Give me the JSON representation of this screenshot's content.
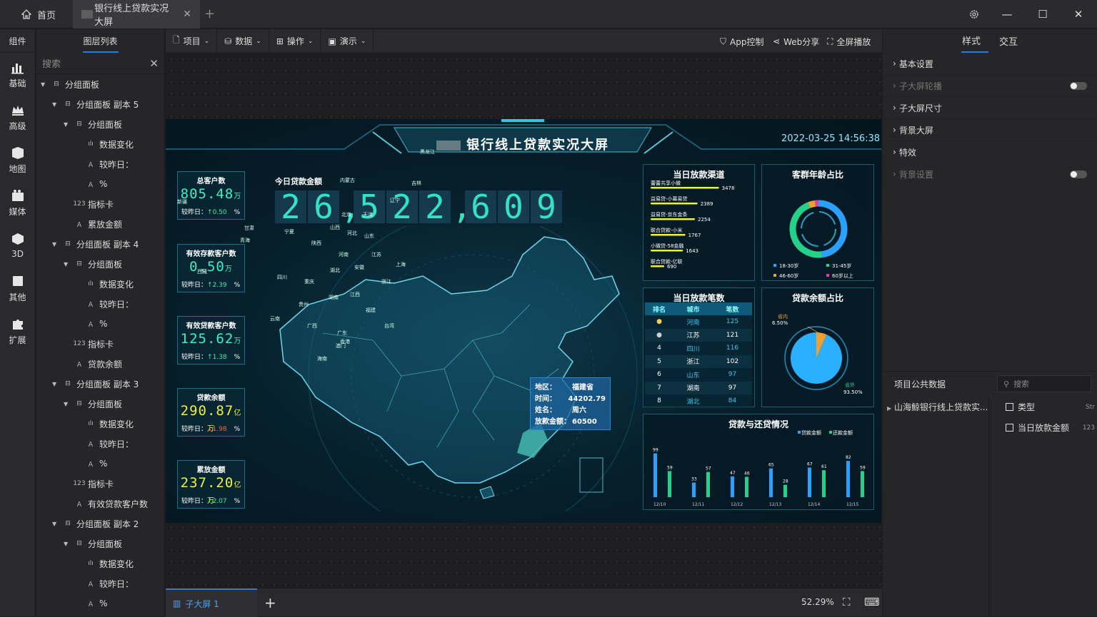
{
  "titlebar": {
    "home_tab": "首页",
    "active_tab": "银行线上贷款实况大屏"
  },
  "leftnav": {
    "title": "组件",
    "items": [
      {
        "label": "基础",
        "icon": "bar-chart-icon"
      },
      {
        "label": "高级",
        "icon": "crown-icon"
      },
      {
        "label": "地图",
        "icon": "map-icon"
      },
      {
        "label": "媒体",
        "icon": "media-icon"
      },
      {
        "label": "3D",
        "icon": "cube-icon"
      },
      {
        "label": "其他",
        "icon": "list-icon"
      },
      {
        "label": "扩展",
        "icon": "puzzle-icon"
      }
    ]
  },
  "layers": {
    "title": "图层列表",
    "search_placeholder": "搜索",
    "rows": [
      {
        "label": "分组面板",
        "level": 0,
        "arrow": true,
        "icon": "group"
      },
      {
        "label": "分组面板 副本 5",
        "level": 1,
        "arrow": true,
        "icon": "group"
      },
      {
        "label": "分组面板",
        "level": 2,
        "arrow": true,
        "icon": "group"
      },
      {
        "label": "数据变化",
        "level": 3,
        "arrow": false,
        "icon": "bar"
      },
      {
        "label": "较昨日：",
        "level": 3,
        "arrow": false,
        "icon": "text"
      },
      {
        "label": "%",
        "level": 3,
        "arrow": false,
        "icon": "text"
      },
      {
        "label": "指标卡",
        "level": 2,
        "arrow": false,
        "icon": "num"
      },
      {
        "label": "累放金额",
        "level": 2,
        "arrow": false,
        "icon": "text"
      },
      {
        "label": "分组面板 副本 4",
        "level": 1,
        "arrow": true,
        "icon": "group"
      },
      {
        "label": "分组面板",
        "level": 2,
        "arrow": true,
        "icon": "group"
      },
      {
        "label": "数据变化",
        "level": 3,
        "arrow": false,
        "icon": "bar"
      },
      {
        "label": "较昨日：",
        "level": 3,
        "arrow": false,
        "icon": "text"
      },
      {
        "label": "%",
        "level": 3,
        "arrow": false,
        "icon": "text"
      },
      {
        "label": "指标卡",
        "level": 2,
        "arrow": false,
        "icon": "num"
      },
      {
        "label": "贷款余额",
        "level": 2,
        "arrow": false,
        "icon": "text"
      },
      {
        "label": "分组面板 副本 3",
        "level": 1,
        "arrow": true,
        "icon": "group"
      },
      {
        "label": "分组面板",
        "level": 2,
        "arrow": true,
        "icon": "group"
      },
      {
        "label": "数据变化",
        "level": 3,
        "arrow": false,
        "icon": "bar"
      },
      {
        "label": "较昨日：",
        "level": 3,
        "arrow": false,
        "icon": "text"
      },
      {
        "label": "%",
        "level": 3,
        "arrow": false,
        "icon": "text"
      },
      {
        "label": "指标卡",
        "level": 2,
        "arrow": false,
        "icon": "num"
      },
      {
        "label": "有效贷款客户数",
        "level": 2,
        "arrow": false,
        "icon": "text"
      },
      {
        "label": "分组面板 副本 2",
        "level": 1,
        "arrow": true,
        "icon": "group"
      },
      {
        "label": "分组面板",
        "level": 2,
        "arrow": true,
        "icon": "group"
      },
      {
        "label": "数据变化",
        "level": 3,
        "arrow": false,
        "icon": "bar"
      },
      {
        "label": "较昨日：",
        "level": 3,
        "arrow": false,
        "icon": "text"
      },
      {
        "label": "%",
        "level": 3,
        "arrow": false,
        "icon": "text"
      }
    ]
  },
  "toolbar": {
    "menus": [
      "项目",
      "数据",
      "操作",
      "演示"
    ],
    "app_control": "App控制",
    "web_share": "Web分享",
    "fullscreen": "全屏播放"
  },
  "bottombar": {
    "sub_screen": "子大屏 1",
    "zoom": "52.29%"
  },
  "props": {
    "tabs": [
      "样式",
      "交互"
    ],
    "rows": [
      {
        "label": "基本设置",
        "dim": false,
        "toggle": false
      },
      {
        "label": "子大屏轮播",
        "dim": true,
        "toggle": true
      },
      {
        "label": "子大屏尺寸",
        "dim": false,
        "toggle": false
      },
      {
        "label": "背景大屏",
        "dim": false,
        "toggle": false
      },
      {
        "label": "特效",
        "dim": false,
        "toggle": false
      },
      {
        "label": "背景设置",
        "dim": true,
        "toggle": true
      }
    ],
    "public_data_title": "项目公共数据",
    "search_placeholder": "搜索",
    "project_item": "山海鲸银行线上贷款实...",
    "fields": [
      {
        "label": "类型",
        "type": "Str"
      },
      {
        "label": "当日放款金额",
        "type": "123"
      }
    ]
  },
  "screen": {
    "title": "银行线上贷款实况大屏",
    "datetime": "2022-03-25 14:56:38",
    "today_amount_label": "今日贷款金额",
    "today_amount": "26,522,609",
    "kpis": [
      {
        "title": "总客户数",
        "value": "805.48",
        "unit": "万",
        "compare_label": "较昨日：",
        "change": "0.50",
        "dir": "up",
        "pct": "%"
      },
      {
        "title": "有效存款客户数",
        "value": "0.50",
        "unit": "万",
        "compare_label": "较昨日：",
        "change": "2.39",
        "dir": "up",
        "pct": "%"
      },
      {
        "title": "有效贷款客户数",
        "value": "125.62",
        "unit": "万",
        "compare_label": "较昨日：",
        "change": "1.38",
        "dir": "up",
        "pct": "%"
      },
      {
        "title": "贷款余额",
        "value": "290.87",
        "unit": "亿万",
        "compare_label": "较昨日：",
        "change": "1.98",
        "dir": "down",
        "pct": "%"
      },
      {
        "title": "累放金额",
        "value": "237.20",
        "unit": "亿万",
        "compare_label": "较昨日：",
        "change": "2.07",
        "dir": "up",
        "pct": "%"
      }
    ],
    "map_tooltip": {
      "rows": [
        {
          "k": "地区：",
          "v": "福建省"
        },
        {
          "k": "时间：",
          "v": "44202.79"
        },
        {
          "k": "姓名：",
          "v": "周六"
        },
        {
          "k": "放款金额：",
          "v": "60500"
        }
      ]
    },
    "map_labels": [
      "新疆",
      "西藏",
      "青海",
      "甘肃",
      "内蒙古",
      "黑龙江",
      "吉林",
      "辽宁",
      "北京",
      "天津",
      "河北",
      "山西",
      "陕西",
      "宁夏",
      "山东",
      "河南",
      "江苏",
      "安徽",
      "湖北",
      "四川",
      "重庆",
      "湖南",
      "江西",
      "浙江",
      "福建",
      "贵州",
      "云南",
      "广西",
      "广东",
      "海南",
      "台湾",
      "上海",
      "香港",
      "澳门"
    ],
    "channel_panel": {
      "title": "当日放款渠道"
    },
    "age_panel": {
      "title": "客群年龄占比",
      "legend": [
        "18-30岁",
        "31-45岁",
        "46-60岁",
        "60岁以上"
      ]
    },
    "count_panel": {
      "title": "当日放款笔数",
      "headers": [
        "排名",
        "城市",
        "笔数"
      ],
      "rows": [
        {
          "rank": "",
          "city": "河南",
          "count": "125",
          "medal": "gold"
        },
        {
          "rank": "",
          "city": "江苏",
          "count": "121",
          "medal": "silver"
        },
        {
          "rank": "4",
          "city": "四川",
          "count": "116",
          "medal": ""
        },
        {
          "rank": "5",
          "city": "浙江",
          "count": "102",
          "medal": ""
        },
        {
          "rank": "6",
          "city": "山东",
          "count": "97",
          "medal": ""
        },
        {
          "rank": "7",
          "city": "湖南",
          "count": "97",
          "medal": ""
        },
        {
          "rank": "8",
          "city": "湖北",
          "count": "84",
          "medal": ""
        }
      ]
    },
    "balance_panel": {
      "title": "贷款余额占比",
      "inner_label": "省内",
      "inner_pct": "6.50%",
      "outer_label": "省外",
      "outer_pct": "93.50%"
    },
    "repay_panel": {
      "title": "贷款与还贷情况",
      "legend": [
        "贷款金额",
        "还款金额"
      ]
    },
    "colors": {
      "teal": "#3cf0c8",
      "blue": "#2aa0ff",
      "green": "#23d18b",
      "orange": "#f0a030",
      "pink": "#e040a0",
      "yellow": "#f0f040"
    }
  },
  "chart_data": [
    {
      "type": "bar",
      "title": "当日放款渠道",
      "categories": [
        "蕾蕾共享小微",
        "益易贷-小幕易贷",
        "益易贷-京东金条",
        "联合贷款-小米",
        "小微贷-58金融",
        "联合贷款-亿联"
      ],
      "values": [
        3478,
        2389,
        2254,
        1767,
        1643,
        690
      ]
    },
    {
      "type": "pie",
      "title": "客群年龄占比",
      "categories": [
        "18-30岁",
        "31-45岁",
        "46-60岁",
        "60岁以上"
      ],
      "values": [
        48,
        46,
        4,
        2
      ]
    },
    {
      "type": "pie",
      "title": "贷款余额占比",
      "categories": [
        "省内",
        "省外"
      ],
      "values": [
        6.5,
        93.5
      ]
    },
    {
      "type": "bar",
      "title": "贷款与还贷情况",
      "categories": [
        "12/10",
        "12/11",
        "12/12",
        "12/13",
        "12/14",
        "12/15"
      ],
      "series": [
        {
          "name": "贷款金额",
          "values": [
            99,
            33,
            47,
            65,
            67,
            82
          ]
        },
        {
          "name": "还款金额",
          "values": [
            59,
            57,
            46,
            28,
            61,
            59
          ]
        }
      ]
    }
  ]
}
